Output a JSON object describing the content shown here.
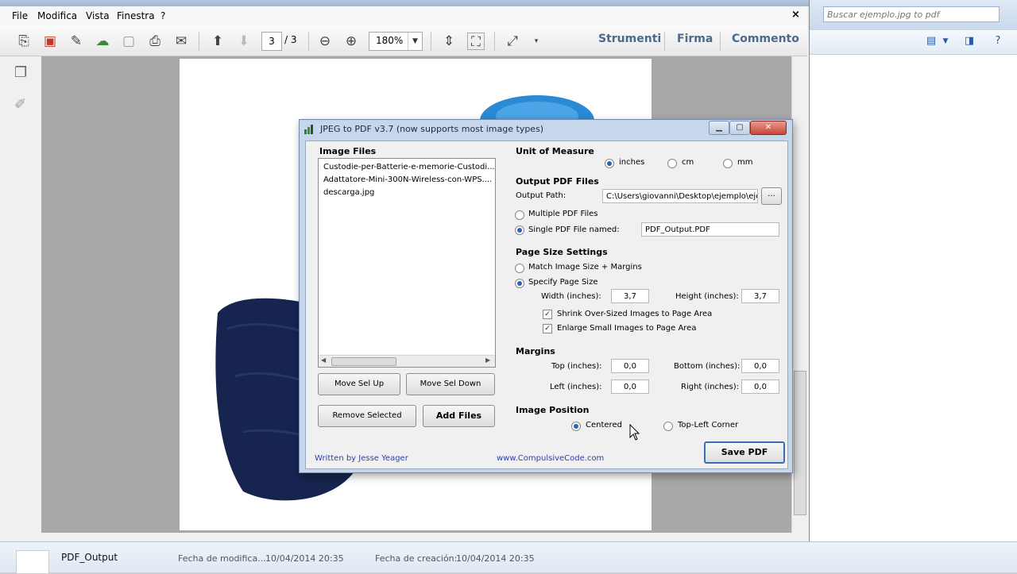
{
  "explorer": {
    "search_placeholder": "Buscar ejemplo.jpg to pdf"
  },
  "details_pane": {
    "file_name": "PDF_Output",
    "modified_label": "Fecha de modifica...",
    "modified_value": "10/04/2014 20:35",
    "created_label": "Fecha de creación:",
    "created_value": "10/04/2014 20:35"
  },
  "reader": {
    "menu": [
      "File",
      "Modifica",
      "Vista",
      "Finestra",
      "?"
    ],
    "close": "×",
    "page_current": "3",
    "page_total": "/ 3",
    "zoom": "180%",
    "panel_tabs": [
      "Strumenti",
      "Firma",
      "Commento"
    ]
  },
  "dialog": {
    "title": "JPEG to PDF  v3.7    (now supports most image types)",
    "image_files_title": "Image Files",
    "files": [
      "Custodie-per-Batterie-e-memorie-Custodi...",
      "Adattatore-Mini-300N-Wireless-con-WPS....",
      "descarga.jpg"
    ],
    "buttons": {
      "move_up": "Move Sel Up",
      "move_down": "Move Sel Down",
      "remove": "Remove Selected",
      "add": "Add Files",
      "save": "Save PDF",
      "browse": "..."
    },
    "unit": {
      "title": "Unit of Measure",
      "options": [
        "inches",
        "cm",
        "mm"
      ],
      "selected": "inches"
    },
    "output": {
      "title": "Output PDF Files",
      "path_label": "Output Path:",
      "path_value": "C:\\Users\\giovanni\\Desktop\\ejemplo\\ejer",
      "multiple_label": "Multiple PDF Files",
      "single_label": "Single PDF File named:",
      "single_value": "PDF_Output.PDF"
    },
    "page_size": {
      "title": "Page Size Settings",
      "match_label": "Match Image Size + Margins",
      "specify_label": "Specify Page Size",
      "width_label": "Width (inches):",
      "width_value": "3,7",
      "height_label": "Height (inches):",
      "height_value": "3,7",
      "shrink_label": "Shrink Over-Sized Images to Page Area",
      "enlarge_label": "Enlarge Small Images to Page Area"
    },
    "margins": {
      "title": "Margins",
      "top_label": "Top (inches):",
      "top_value": "0,0",
      "bottom_label": "Bottom (inches):",
      "bottom_value": "0,0",
      "left_label": "Left (inches):",
      "left_value": "0,0",
      "right_label": "Right (inches):",
      "right_value": "0,0"
    },
    "image_position": {
      "title": "Image Position",
      "centered_label": "Centered",
      "topleft_label": "Top-Left Corner"
    },
    "footer": {
      "author": "Written by Jesse Yeager",
      "site": "www.CompulsiveCode.com"
    }
  },
  "colors": {
    "accent": "#2d63b4",
    "link": "#2a3fb0",
    "cursor_highlight": "#fff000"
  }
}
